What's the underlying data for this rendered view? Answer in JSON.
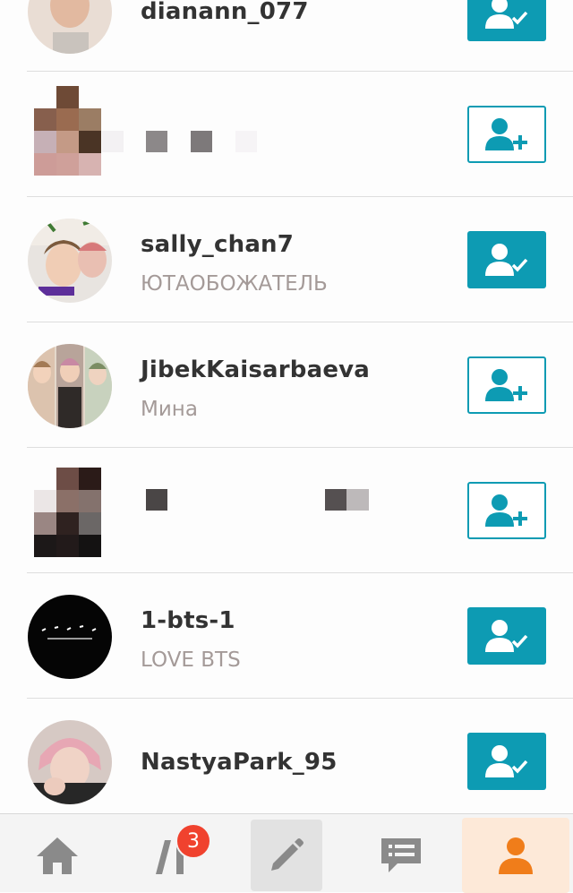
{
  "users": [
    {
      "username": "dianann_077",
      "status": "",
      "follow_state": "following"
    },
    {
      "username": "",
      "status": "",
      "follow_state": "follow"
    },
    {
      "username": "sally_chan7",
      "status": "ЮТАОБОЖАТЕЛЬ",
      "follow_state": "following"
    },
    {
      "username": "JibekKaisarbaeva",
      "status": "Мина",
      "follow_state": "follow"
    },
    {
      "username": "",
      "status": "",
      "follow_state": "follow"
    },
    {
      "username": "1-bts-1",
      "status": "LOVE BTS",
      "follow_state": "following"
    },
    {
      "username": "NastyaPark_95",
      "status": "",
      "follow_state": "following"
    }
  ],
  "tabbar": {
    "tabs": [
      {
        "icon": "home-icon"
      },
      {
        "icon": "feed-icon",
        "badge": "3"
      },
      {
        "icon": "pencil-icon"
      },
      {
        "icon": "chat-icon"
      },
      {
        "icon": "profile-icon",
        "active": true
      }
    ]
  },
  "colors": {
    "accent": "#0d9bb3",
    "badge": "#f0422e",
    "active_tab_bg": "#fde9d8",
    "active_tab_icon": "#f07d1a",
    "inactive_tab_icon": "#8a8a8a"
  }
}
